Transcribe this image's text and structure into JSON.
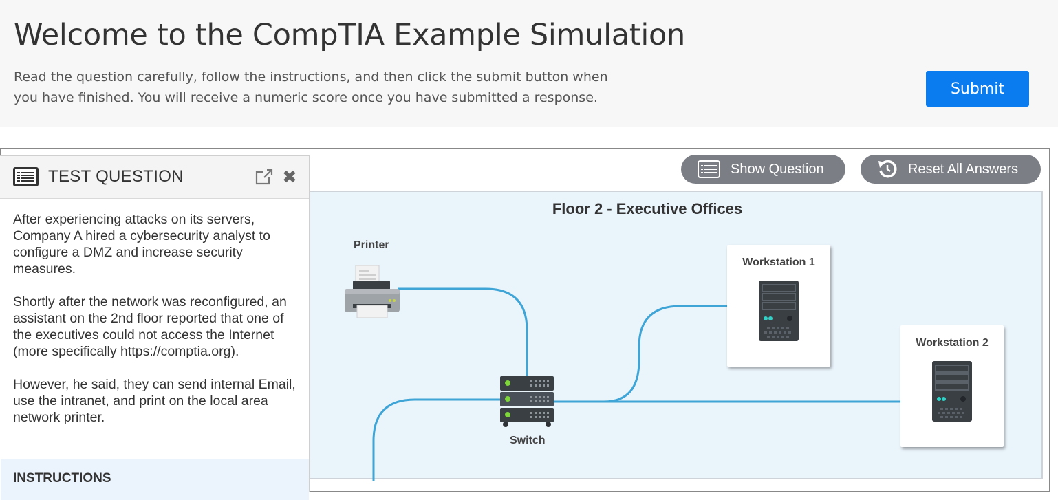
{
  "header": {
    "title": "Welcome to the CompTIA Example Simulation",
    "subtitle_line1": "Read the question carefully, follow the instructions, and then click the submit button when",
    "subtitle_line2": "you have finished. You will receive a numeric score once you have submitted a response.",
    "submit_label": "Submit",
    "accent_color": "#0a7cf0"
  },
  "question_panel": {
    "title": "TEST QUESTION",
    "paragraph1": "After experiencing attacks on its servers, Company A hired a cybersecurity analyst to configure a DMZ and increase security measures.",
    "paragraph2": "Shortly after the network was reconfigured, an assistant on the 2nd floor reported that one of the executives could not access the Internet (more specifically https://comptia.org).",
    "paragraph3": "However, he said, they can send internal Email, use the intranet, and print on the local area network printer.",
    "instructions_label": "INSTRUCTIONS",
    "icons": [
      "list-icon",
      "popout-icon",
      "close-icon"
    ]
  },
  "toolbar": {
    "show_question_label": "Show Question",
    "reset_label": "Reset All Answers",
    "icons": [
      "list-icon",
      "reset-icon"
    ]
  },
  "diagram": {
    "floor_title": "Floor 2 - Executive Offices",
    "printer_label": "Printer",
    "switch_label": "Switch",
    "workstation1_label": "Workstation 1",
    "workstation2_label": "Workstation 2",
    "cable_color": "#3ea5d6"
  }
}
